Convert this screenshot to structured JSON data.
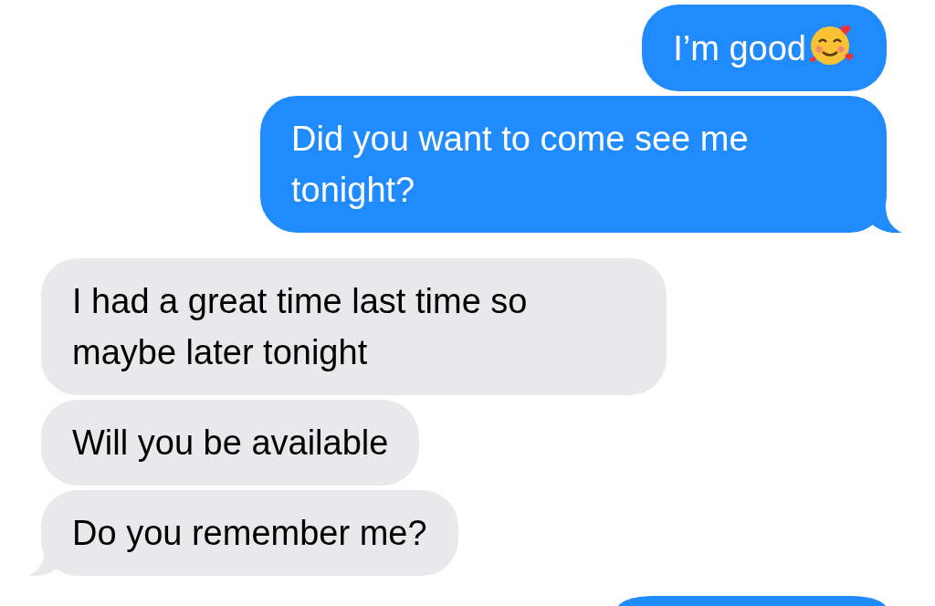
{
  "messages": [
    {
      "kind": "sent",
      "text": "I’m good",
      "emoji": true,
      "tail": false
    },
    {
      "kind": "sent",
      "text": "Did you want to come see me tonight?",
      "emoji": false,
      "tail": true
    },
    {
      "kind": "received",
      "text": "I had a great time last time so maybe later tonight",
      "emoji": false,
      "tail": false
    },
    {
      "kind": "received",
      "text": "Will you be available",
      "emoji": false,
      "tail": false
    },
    {
      "kind": "received",
      "text": "Do you remember me?",
      "emoji": false,
      "tail": true
    }
  ]
}
